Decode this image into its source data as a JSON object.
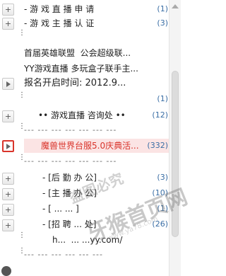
{
  "rows": [
    {
      "text": "- 游 戏 直 播 申 请",
      "count": "(1)",
      "expander": "+"
    },
    {
      "text": "- 游 戏 主 播 认 证",
      "count": "(3)",
      "expander": "+"
    },
    {
      "text": "",
      "count": "",
      "expander": ""
    },
    {
      "text": "首届英雄联盟  公会超级联...",
      "count": "",
      "expander": ""
    },
    {
      "text": "YY游戏直播 多玩盒子联手主...",
      "count": "",
      "expander": ""
    },
    {
      "text": "报名开启时间: 2012.9...",
      "count": "",
      "expander": "play"
    },
    {
      "text": "",
      "count": "(1)",
      "expander": ""
    },
    {
      "text": "•• 游戏直播 咨询处 ••",
      "count": "(12)",
      "expander": "+"
    },
    {
      "text": "--- --- --- --- --- --- ---",
      "count": "",
      "expander": ""
    },
    {
      "text": "魔兽世界台服5.0庆典活...",
      "count": "(332)",
      "expander": "play"
    },
    {
      "text": "--- --- --- --- --- --- ---",
      "count": "",
      "expander": ""
    },
    {
      "text": "- [后 勤 办 公]",
      "count": "(3)",
      "expander": "+"
    },
    {
      "text": "- [主 播 办 公]",
      "count": "(10)",
      "expander": "+"
    },
    {
      "text": "- [ ... ... ]",
      "count": "(1)",
      "expander": "+"
    },
    {
      "text": "- [招 聘 ... 处]",
      "count": "(26)",
      "expander": "+"
    },
    {
      "text": "h...  ... ...yy.com/",
      "count": "",
      "expander": ""
    },
    {
      "text": "--- --- --- --- --- ---",
      "count": "",
      "expander": ""
    }
  ],
  "watermark": {
    "line1": "盗图必究",
    "line2": "牙猴首页网",
    "line3": "www.ya78.com"
  },
  "icons": {
    "expand": "plus-icon",
    "play": "play-icon",
    "scroll_up": "arrow-up-icon"
  }
}
